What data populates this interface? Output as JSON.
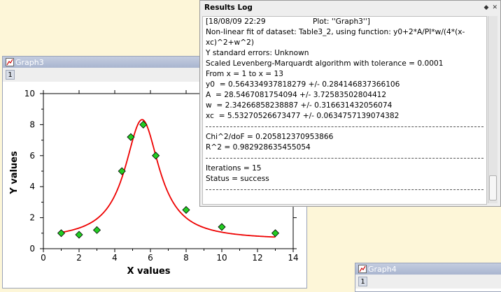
{
  "graph3": {
    "title": "Graph3",
    "layer_button": "1"
  },
  "graph4": {
    "title": "Graph4",
    "layer_button": "1"
  },
  "results_log": {
    "title": "Results Log",
    "controls": [
      "◆",
      "✕"
    ],
    "lines": [
      "[18/08/09 22:29                    Plot: ''Graph3'']",
      "Non-linear fit of dataset: Table3_2, using function: y0+2*A/PI*w/(4*(x-xc)^2+w^2)",
      "Y standard errors: Unknown",
      "Scaled Levenberg-Marquardt algorithm with tolerance = 0.0001",
      "From x = 1 to x = 13",
      "y0  = 0.564334937818279 +/- 0.284146837366106",
      "A  = 28.5467081754094 +/- 3.72583502804412",
      "w  = 2.34266858238887 +/- 0.316631432056074",
      "xc  = 5.53270526673477 +/- 0.0634757139074382",
      "Chi^2/doF = 0.205812370953866",
      "R^2 = 0.982928635455054",
      "Iterations = 15",
      "Status = success"
    ]
  },
  "chart_data": {
    "type": "scatter",
    "xlabel": "X values",
    "ylabel": "Y values",
    "xlim": [
      0,
      14
    ],
    "ylim": [
      0,
      10
    ],
    "xticks": [
      0,
      2,
      4,
      6,
      8,
      10,
      12,
      14
    ],
    "yticks": [
      0,
      2,
      4,
      6,
      8,
      10
    ],
    "series": [
      {
        "kind": "points",
        "color": "#22cc22",
        "marker": "diamond",
        "x": [
          1,
          2,
          3,
          4.4,
          4.9,
          5.6,
          6.3,
          8,
          10,
          13
        ],
        "y": [
          1.0,
          0.9,
          1.2,
          5.0,
          7.2,
          8.0,
          6.0,
          2.5,
          1.4,
          1.0
        ]
      },
      {
        "kind": "fit",
        "color": "#ee0000",
        "function": "y0+2*A/PI*w/(4*(x-xc)^2+w^2)",
        "params": {
          "y0": 0.564334937818279,
          "A": 28.5467081754094,
          "w": 2.34266858238887,
          "xc": 5.53270526673477
        },
        "x_from": 1,
        "x_to": 13
      }
    ]
  }
}
